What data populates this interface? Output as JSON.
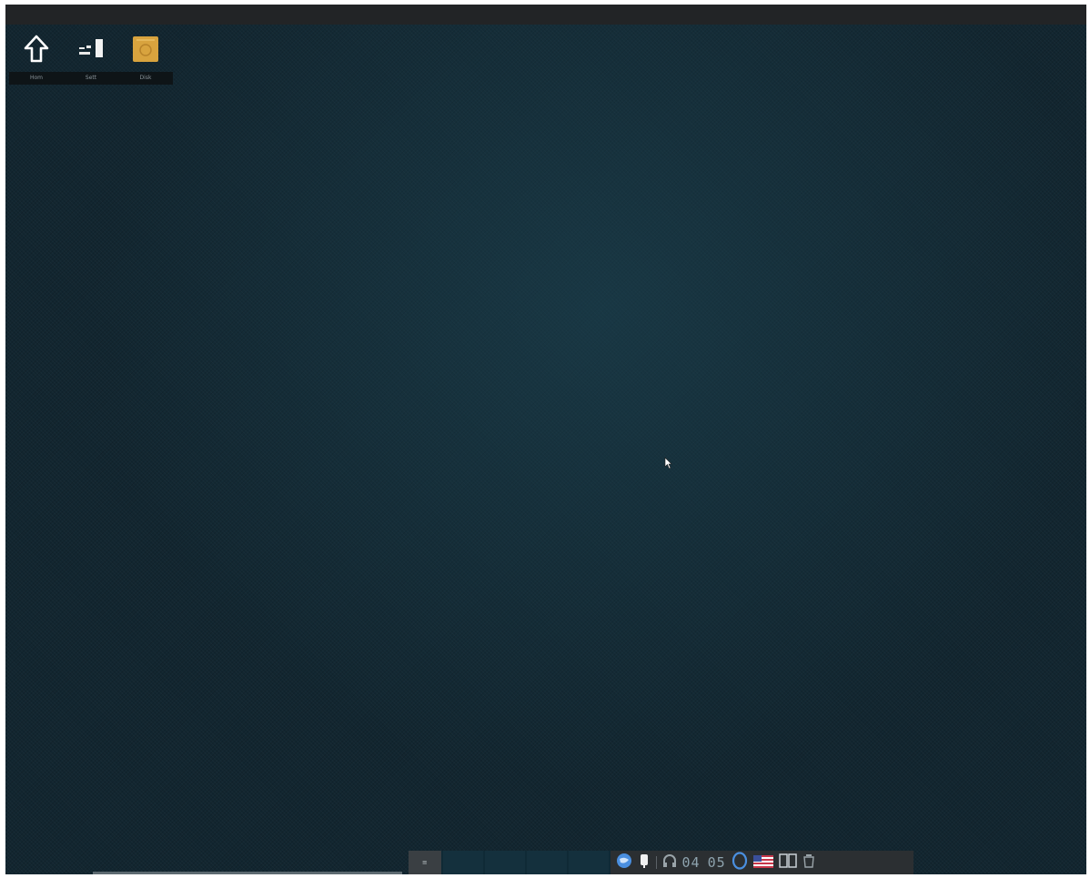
{
  "desktop": {
    "icons": [
      {
        "name": "home",
        "label": "Hom"
      },
      {
        "name": "trash",
        "label": "Sett"
      },
      {
        "name": "drive",
        "label": "Disk"
      }
    ]
  },
  "taskbar": {
    "start_label": "≡",
    "clock": {
      "hour": "04",
      "minute": "05"
    },
    "colors": {
      "accent": "#4a8fe0",
      "panel": "#2b2f32",
      "wallpaper": "#122630"
    }
  }
}
